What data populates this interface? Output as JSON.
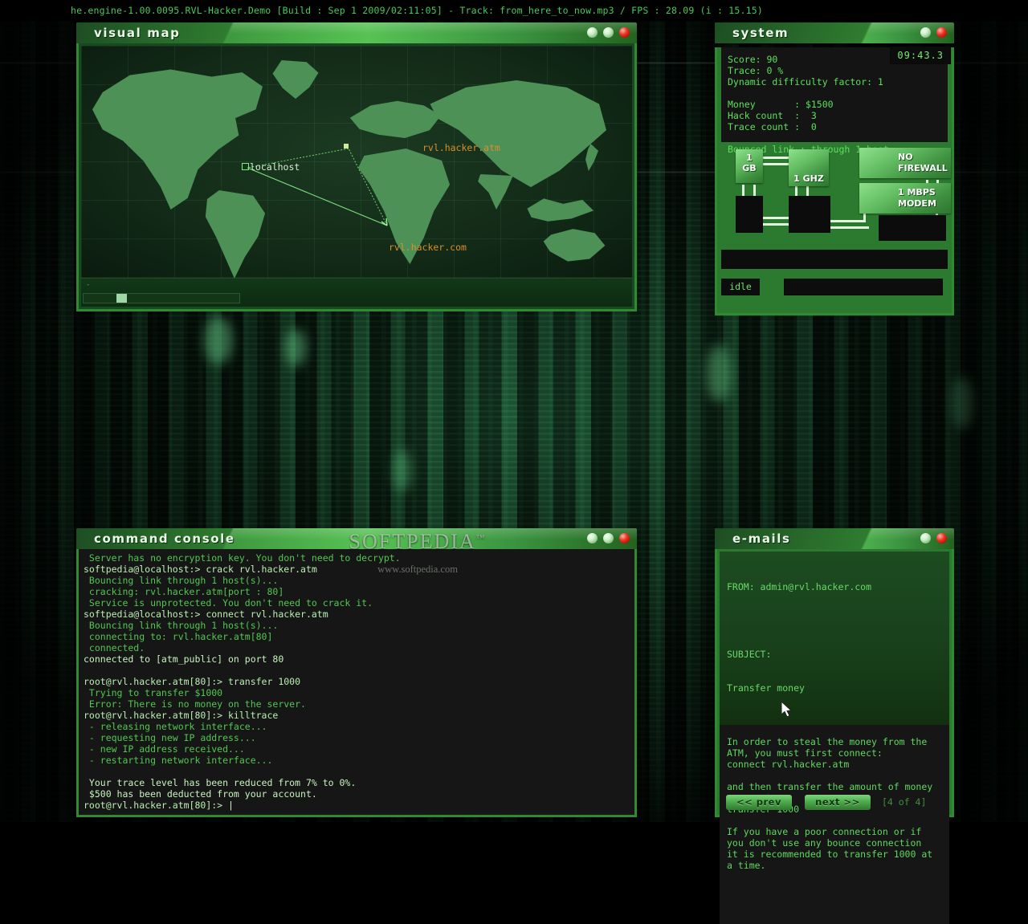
{
  "app": {
    "title_bar": "he.engine-1.00.0095.RVL-Hacker.Demo [Build : Sep  1 2009/02:11:05] - Track: from_here_to_now.mp3 / FPS : 28.09 (i : 15.15)"
  },
  "watermark": {
    "brand": "SOFTPEDIA",
    "tm": "™",
    "url": "www.softpedia.com"
  },
  "colors": {
    "accent_green": "#3f9a3f",
    "text_green": "#55d455",
    "label_orange": "#d98f2a",
    "close_red": "#ee3322"
  },
  "map_window": {
    "title": "visual map",
    "nodes": [
      {
        "label": "localhost",
        "color": "white"
      },
      {
        "label": "rvl.hacker.atm",
        "color": "orange"
      },
      {
        "label": "rvl.hacker.com",
        "color": "orange"
      }
    ],
    "scroll_tick": "-"
  },
  "system_window": {
    "title": "system",
    "clock": "09:43.3",
    "stats": [
      "Score: 90",
      "Trace: 0 %",
      "Dynamic difficulty factor: 1",
      "",
      "Money       : $1500",
      "Hack count  :  3",
      "Trace count :  0",
      "",
      "Bounced link : through 1 host"
    ],
    "hardware": {
      "ram": "1\nGB",
      "cpu": "1 GHZ",
      "firewall": "NO\nFIREWALL",
      "modem": "1 MBPS\nMODEM"
    },
    "status": "idle"
  },
  "console_window": {
    "title": "command console",
    "lines": [
      {
        "text": " Server has no encryption key. You don't need to decrypt.",
        "style": "err"
      },
      {
        "text": "softpedia@localhost:> crack rvl.hacker.atm",
        "style": "prompt"
      },
      {
        "text": " Bouncing link through 1 host(s)...",
        "style": "err"
      },
      {
        "text": " cracking: rvl.hacker.atm[port : 80]",
        "style": "err"
      },
      {
        "text": " Service is unprotected. You don't need to crack it.",
        "style": "err"
      },
      {
        "text": "softpedia@localhost:> connect rvl.hacker.atm",
        "style": "prompt"
      },
      {
        "text": " Bouncing link through 1 host(s)...",
        "style": "err"
      },
      {
        "text": " connecting to: rvl.hacker.atm[80]",
        "style": "err"
      },
      {
        "text": " connected.",
        "style": "err"
      },
      {
        "text": "connected to [atm_public] on port 80",
        "style": "bright"
      },
      {
        "text": "",
        "style": "err"
      },
      {
        "text": "root@rvl.hacker.atm[80]:> transfer 1000",
        "style": "prompt"
      },
      {
        "text": " Trying to transfer $1000",
        "style": "err"
      },
      {
        "text": " Error: There is no money on the server.",
        "style": "err"
      },
      {
        "text": "root@rvl.hacker.atm[80]:> killtrace",
        "style": "prompt"
      },
      {
        "text": " - releasing network interface...",
        "style": "err"
      },
      {
        "text": " - requesting new IP address...",
        "style": "err"
      },
      {
        "text": " - new IP address received...",
        "style": "err"
      },
      {
        "text": " - restarting network interface...",
        "style": "err"
      },
      {
        "text": "",
        "style": "err"
      },
      {
        "text": " Your trace level has been reduced from 7% to 0%.",
        "style": "bright"
      },
      {
        "text": " $500 has been deducted from your account.",
        "style": "bright"
      }
    ],
    "input_prompt": "root@rvl.hacker.atm[80]:> "
  },
  "email_window": {
    "title": "e-mails",
    "from_label": "FROM: admin@rvl.hacker.com",
    "subject_label": "SUBJECT:",
    "subject": "Transfer money",
    "body": "In order to steal the money from the\nATM, you must first connect:\nconnect rvl.hacker.atm\n\nand then transfer the amount of money\nyou want:\ntransfer 1000\n\nIf you have a poor connection or if\nyou don't use any bounce connection\nit is recommended to transfer 1000 at\na time.",
    "prev_label": "<< prev",
    "next_label": "next >>",
    "counter": "[4 of 4]"
  }
}
